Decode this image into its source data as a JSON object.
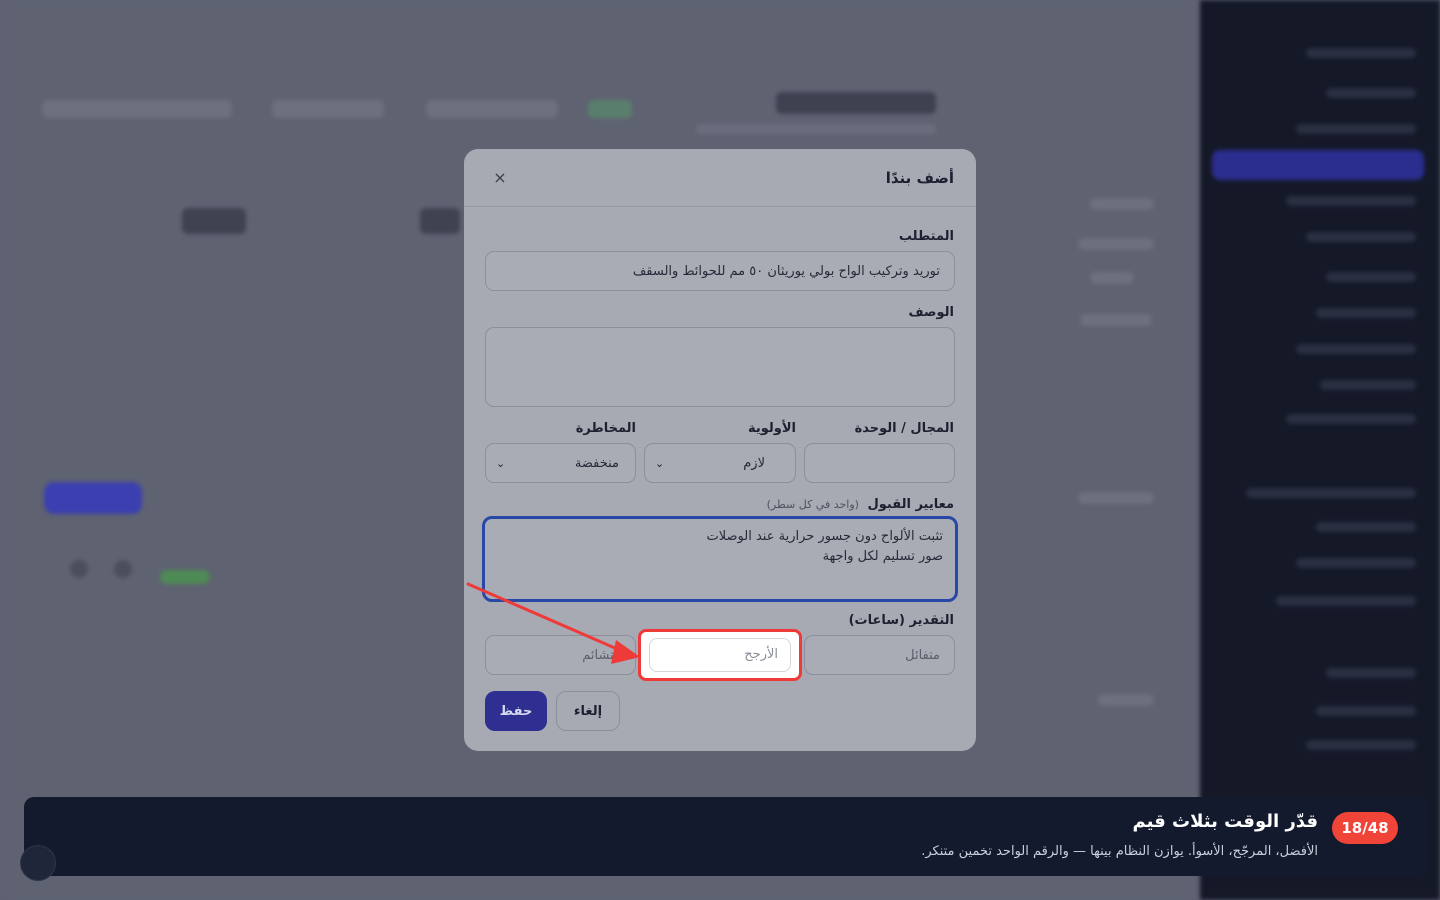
{
  "modal": {
    "title": "أضف بندًا",
    "close_icon": "×",
    "requirement": {
      "label": "المتطلب",
      "value": "توريد وتركيب الواح بولي يوريثان ٥٠ مم للحوائط والسقف"
    },
    "description": {
      "label": "الوصف",
      "value": ""
    },
    "domain": {
      "label": "المجال / الوحدة",
      "value": ""
    },
    "priority": {
      "label": "الأولوية",
      "value": "لازم"
    },
    "risk": {
      "label": "المخاطرة",
      "value": "منخفضة"
    },
    "acceptance": {
      "label": "معايير القبول",
      "hint": "(واحد في كل سطر)",
      "line1": "تثبت الألواح دون جسور حرارية عند الوصلات",
      "line2": "صور تسليم لكل واجهة"
    },
    "estimate": {
      "label": "التقدير (ساعات)",
      "optimistic_placeholder": "متفائل",
      "likely_placeholder": "الأرجح",
      "pessimistic_placeholder": "متشائم"
    },
    "buttons": {
      "save": "حفظ",
      "cancel": "إلغاء"
    }
  },
  "tour": {
    "step": "18/48",
    "title": "قدّر الوقت بثلاث قيم",
    "text": "الأفضل، المرجّح، الأسوأ. يوازن النظام بينها — والرقم الواحد تخمين متنكر."
  },
  "colors": {
    "accent": "#2e2f91",
    "focus_border": "#2848a8",
    "highlight": "#ef3a3a",
    "tour_bg": "#141a2e",
    "badge": "#f04438"
  }
}
